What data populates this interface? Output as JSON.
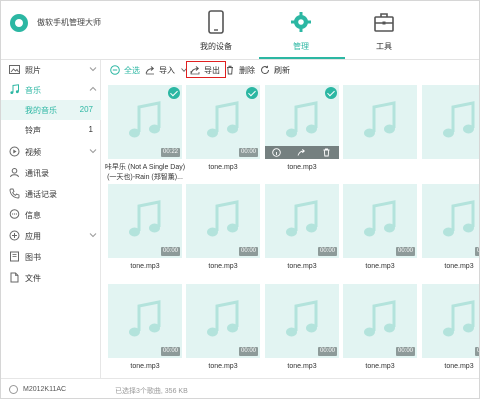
{
  "header": {
    "app_title": "傲软手机管理大师",
    "tabs": [
      {
        "label": "我的设备",
        "icon": "phone-icon",
        "active": false
      },
      {
        "label": "管理",
        "icon": "gear-icon",
        "active": true
      },
      {
        "label": "工具",
        "icon": "toolbox-icon",
        "active": false
      }
    ]
  },
  "colors": {
    "accent": "#2cb7a3",
    "tile_bg": "#e2f4f2",
    "highlight_border": "#e02020"
  },
  "sidebar": {
    "items": [
      {
        "label": "照片",
        "icon": "photo-icon",
        "expandable": true
      },
      {
        "label": "音乐",
        "icon": "music-icon",
        "expandable": true
      },
      {
        "label": "我的音乐",
        "count": "207",
        "active": true
      },
      {
        "label": "铃声",
        "count": "1"
      },
      {
        "label": "视频",
        "icon": "video-icon",
        "expandable": true
      },
      {
        "label": "通讯录",
        "icon": "contacts-icon"
      },
      {
        "label": "通话记录",
        "icon": "call-log-icon"
      },
      {
        "label": "信息",
        "icon": "message-icon"
      },
      {
        "label": "应用",
        "icon": "apps-icon",
        "expandable": true
      },
      {
        "label": "图书",
        "icon": "book-icon"
      },
      {
        "label": "文件",
        "icon": "file-icon"
      }
    ]
  },
  "toolbar": {
    "select_all": "全选",
    "import": "导入",
    "export": "导出",
    "delete": "删除",
    "refresh": "刷新"
  },
  "grid": {
    "tiles": [
      {
        "name": "咔早乐 (Not A Single Day)",
        "name2": "(一天也)-Rain (郑智薫)...",
        "duration": "00:22",
        "selected": true
      },
      {
        "name": "tone.mp3",
        "duration": "00:00",
        "selected": true
      },
      {
        "name": "tone.mp3",
        "duration": "",
        "selected": true,
        "hover": true
      },
      {
        "name": "",
        "duration": ""
      },
      {
        "name": "",
        "duration": ""
      },
      {
        "name": "tone.mp3",
        "duration": "00:00"
      },
      {
        "name": "tone.mp3",
        "duration": "00:00"
      },
      {
        "name": "tone.mp3",
        "duration": "00:00"
      },
      {
        "name": "tone.mp3",
        "duration": "00:00"
      },
      {
        "name": "tone.mp3",
        "duration": "00:00"
      },
      {
        "name": "tone.mp3",
        "duration": "00:00"
      },
      {
        "name": "tone.mp3",
        "duration": "00:00"
      },
      {
        "name": "tone.mp3",
        "duration": "00:00"
      },
      {
        "name": "tone.mp3",
        "duration": "00:00"
      },
      {
        "name": "tone.mp3",
        "duration": "00:00"
      }
    ]
  },
  "footer": {
    "device_name": "M2012K11AC",
    "selection_status": "已选择3个歌曲, 356 KB"
  }
}
